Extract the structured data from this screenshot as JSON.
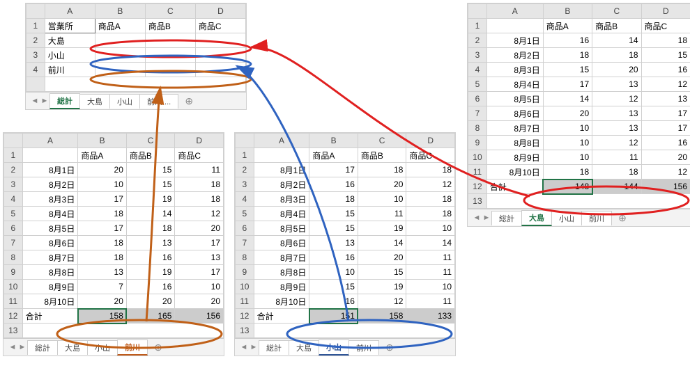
{
  "summary": {
    "col_headers": [
      "A",
      "B",
      "C",
      "D"
    ],
    "row_headers": [
      "1",
      "2",
      "3",
      "4"
    ],
    "r1": [
      "営業所",
      "商品A",
      "商品B",
      "商品C"
    ],
    "r2": [
      "大島",
      "",
      "",
      ""
    ],
    "r3": [
      "小山",
      "",
      "",
      ""
    ],
    "r4": [
      "前川",
      "",
      "",
      ""
    ],
    "tabs": {
      "t0": "総計",
      "t1": "大島",
      "t2": "小山",
      "t3": "前川 ..."
    },
    "active_tab": "総計"
  },
  "oshima": {
    "col_headers": [
      "A",
      "B",
      "C",
      "D"
    ],
    "row_headers": [
      "1",
      "2",
      "3",
      "4",
      "5",
      "6",
      "7",
      "8",
      "9",
      "10",
      "11",
      "12",
      "13"
    ],
    "header_row": [
      "",
      "商品A",
      "商品B",
      "商品C"
    ],
    "rows": [
      [
        "8月1日",
        "16",
        "14",
        "18"
      ],
      [
        "8月2日",
        "18",
        "18",
        "15"
      ],
      [
        "8月3日",
        "15",
        "20",
        "16"
      ],
      [
        "8月4日",
        "17",
        "13",
        "12"
      ],
      [
        "8月5日",
        "14",
        "12",
        "13"
      ],
      [
        "8月6日",
        "20",
        "13",
        "17"
      ],
      [
        "8月7日",
        "10",
        "13",
        "17"
      ],
      [
        "8月8日",
        "10",
        "12",
        "16"
      ],
      [
        "8月9日",
        "10",
        "11",
        "20"
      ],
      [
        "8月10日",
        "18",
        "18",
        "12"
      ]
    ],
    "total_label": "合計",
    "totals": [
      "148",
      "144",
      "156"
    ],
    "tabs": {
      "t0": "総計",
      "t1": "大島",
      "t2": "小山",
      "t3": "前川"
    },
    "active_tab": "大島"
  },
  "koyama": {
    "col_headers": [
      "A",
      "B",
      "C",
      "D"
    ],
    "row_headers": [
      "1",
      "2",
      "3",
      "4",
      "5",
      "6",
      "7",
      "8",
      "9",
      "10",
      "11",
      "12",
      "13"
    ],
    "header_row": [
      "",
      "商品A",
      "商品B",
      "商品C"
    ],
    "rows": [
      [
        "8月1日",
        "17",
        "18",
        "18"
      ],
      [
        "8月2日",
        "16",
        "20",
        "12"
      ],
      [
        "8月3日",
        "18",
        "10",
        "18"
      ],
      [
        "8月4日",
        "15",
        "11",
        "18"
      ],
      [
        "8月5日",
        "15",
        "19",
        "10"
      ],
      [
        "8月6日",
        "13",
        "14",
        "14"
      ],
      [
        "8月7日",
        "16",
        "20",
        "11"
      ],
      [
        "8月8日",
        "10",
        "15",
        "11"
      ],
      [
        "8月9日",
        "15",
        "19",
        "10"
      ],
      [
        "8月10日",
        "16",
        "12",
        "11"
      ]
    ],
    "total_label": "合計",
    "totals": [
      "151",
      "158",
      "133"
    ],
    "tabs": {
      "t0": "総計",
      "t1": "大島",
      "t2": "小山",
      "t3": "前川"
    },
    "active_tab": "小山"
  },
  "maekawa": {
    "col_headers": [
      "A",
      "B",
      "C",
      "D"
    ],
    "row_headers": [
      "1",
      "2",
      "3",
      "4",
      "5",
      "6",
      "7",
      "8",
      "9",
      "10",
      "11",
      "12",
      "13"
    ],
    "header_row": [
      "",
      "商品A",
      "商品B",
      "商品C"
    ],
    "rows": [
      [
        "8月1日",
        "20",
        "15",
        "11"
      ],
      [
        "8月2日",
        "10",
        "15",
        "18"
      ],
      [
        "8月3日",
        "17",
        "19",
        "18"
      ],
      [
        "8月4日",
        "18",
        "14",
        "12"
      ],
      [
        "8月5日",
        "17",
        "18",
        "20"
      ],
      [
        "8月6日",
        "18",
        "13",
        "17"
      ],
      [
        "8月7日",
        "18",
        "16",
        "13"
      ],
      [
        "8月8日",
        "13",
        "19",
        "17"
      ],
      [
        "8月9日",
        "7",
        "16",
        "10"
      ],
      [
        "8月10日",
        "20",
        "20",
        "20"
      ]
    ],
    "total_label": "合計",
    "totals": [
      "158",
      "165",
      "156"
    ],
    "tabs": {
      "t0": "総計",
      "t1": "大島",
      "t2": "小山",
      "t3": "前川"
    },
    "active_tab": "前川"
  },
  "colors": {
    "red": "#e02020",
    "blue": "#2f63c0",
    "orange": "#c06018"
  },
  "chart_data": {
    "type": "table",
    "note": "Four Excel worksheet views connected by arrows showing 合計(totals) rows feeding a summary sheet",
    "series": [
      {
        "name": "大島",
        "categories": [
          "商品A",
          "商品B",
          "商品C"
        ],
        "values": [
          148,
          144,
          156
        ]
      },
      {
        "name": "小山",
        "categories": [
          "商品A",
          "商品B",
          "商品C"
        ],
        "values": [
          151,
          158,
          133
        ]
      },
      {
        "name": "前川",
        "categories": [
          "商品A",
          "商品B",
          "商品C"
        ],
        "values": [
          158,
          165,
          156
        ]
      }
    ]
  }
}
